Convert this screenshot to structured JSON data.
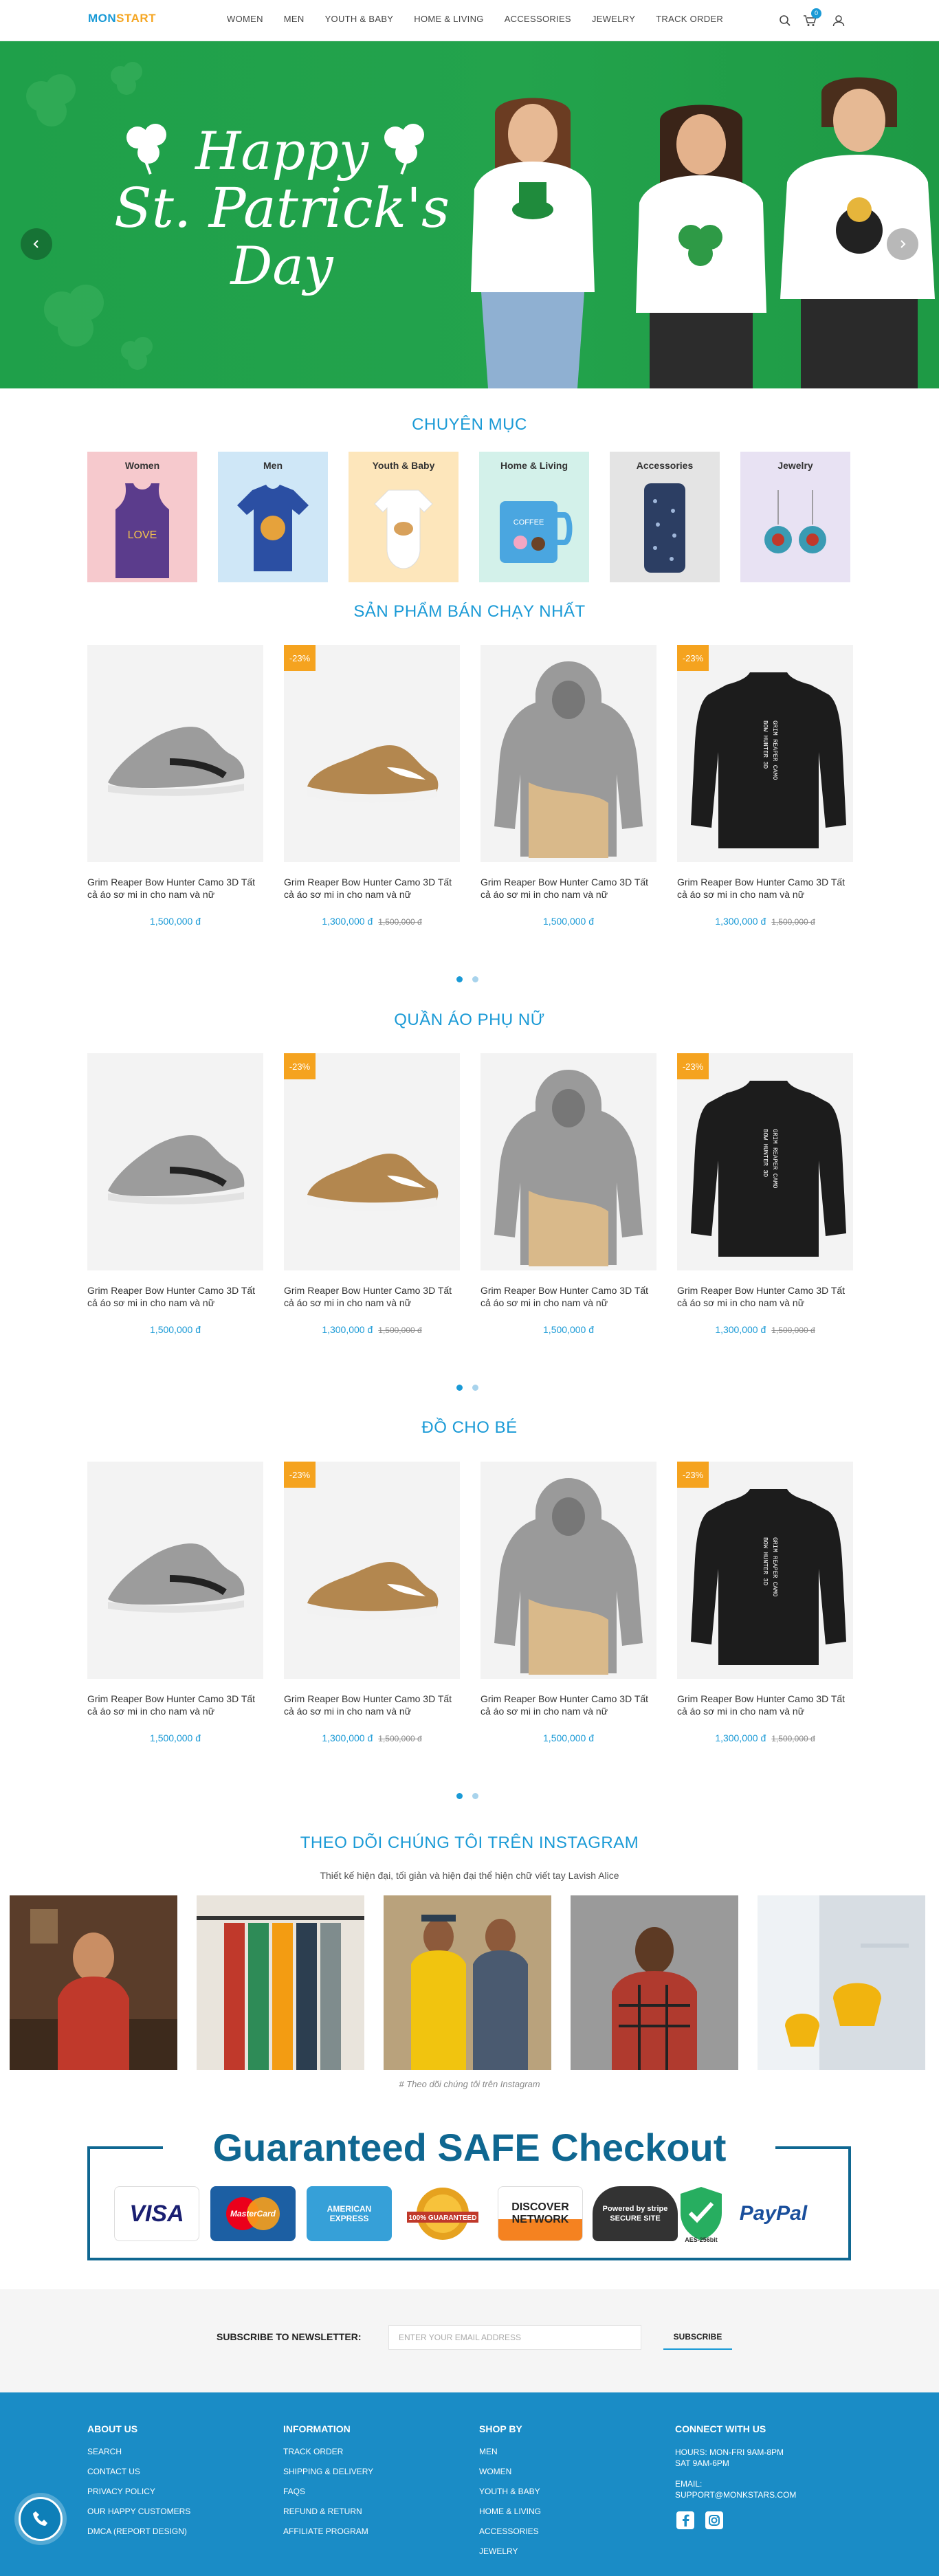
{
  "header": {
    "logo_part1": "MON",
    "logo_part2": "START",
    "nav": [
      "WOMEN",
      "MEN",
      "YOUTH & BABY",
      "HOME & LIVING",
      "ACCESSORIES",
      "JEWELRY",
      "TRACK ORDER"
    ],
    "cart_count": "0"
  },
  "hero": {
    "line1": "Happy",
    "line2": "St. Patrick's",
    "line3": "Day"
  },
  "categories": {
    "title": "CHUYÊN MỤC",
    "items": [
      {
        "label": "Women",
        "bg": "#f6c9cd"
      },
      {
        "label": "Men",
        "bg": "#cfe7f7"
      },
      {
        "label": "Youth & Baby",
        "bg": "#fde6bb"
      },
      {
        "label": "Home & Living",
        "bg": "#d3f1ea"
      },
      {
        "label": "Accessories",
        "bg": "#e4e4e4"
      },
      {
        "label": "Jewelry",
        "bg": "#e8e2f3"
      }
    ]
  },
  "sections": [
    {
      "title": "SẢN PHẨM BÁN CHẠY NHẤT",
      "products": [
        {
          "name": "Grim Reaper Bow Hunter Camo 3D Tất cả áo sơ mi in cho nam và nữ",
          "price": "1,500,000 đ",
          "old_price": "",
          "badge": ""
        },
        {
          "name": "Grim Reaper Bow Hunter Camo 3D Tất cả áo sơ mi in cho nam và nữ",
          "price": "1,300,000 đ",
          "old_price": "1,500,000 đ",
          "badge": "-23%"
        },
        {
          "name": "Grim Reaper Bow Hunter Camo 3D Tất cả áo sơ mi in cho nam và nữ",
          "price": "1,500,000 đ",
          "old_price": "",
          "badge": ""
        },
        {
          "name": "Grim Reaper Bow Hunter Camo 3D Tất cả áo sơ mi in cho nam và nữ",
          "price": "1,300,000 đ",
          "old_price": "1,500,000 đ",
          "badge": "-23%"
        }
      ]
    },
    {
      "title": "QUẦN ÁO PHỤ NỮ",
      "products": [
        {
          "name": "Grim Reaper Bow Hunter Camo 3D Tất cả áo sơ mi in cho nam và nữ",
          "price": "1,500,000 đ",
          "old_price": "",
          "badge": ""
        },
        {
          "name": "Grim Reaper Bow Hunter Camo 3D Tất cả áo sơ mi in cho nam và nữ",
          "price": "1,300,000 đ",
          "old_price": "1,500,000 đ",
          "badge": "-23%"
        },
        {
          "name": "Grim Reaper Bow Hunter Camo 3D Tất cả áo sơ mi in cho nam và nữ",
          "price": "1,500,000 đ",
          "old_price": "",
          "badge": ""
        },
        {
          "name": "Grim Reaper Bow Hunter Camo 3D Tất cả áo sơ mi in cho nam và nữ",
          "price": "1,300,000 đ",
          "old_price": "1,500,000 đ",
          "badge": "-23%"
        }
      ]
    },
    {
      "title": "ĐỒ CHO BÉ",
      "products": [
        {
          "name": "Grim Reaper Bow Hunter Camo 3D Tất cả áo sơ mi in cho nam và nữ",
          "price": "1,500,000 đ",
          "old_price": "",
          "badge": ""
        },
        {
          "name": "Grim Reaper Bow Hunter Camo 3D Tất cả áo sơ mi in cho nam và nữ",
          "price": "1,300,000 đ",
          "old_price": "1,500,000 đ",
          "badge": "-23%"
        },
        {
          "name": "Grim Reaper Bow Hunter Camo 3D Tất cả áo sơ mi in cho nam và nữ",
          "price": "1,500,000 đ",
          "old_price": "",
          "badge": ""
        },
        {
          "name": "Grim Reaper Bow Hunter Camo 3D Tất cả áo sơ mi in cho nam và nữ",
          "price": "1,300,000 đ",
          "old_price": "1,500,000 đ",
          "badge": "-23%"
        }
      ]
    }
  ],
  "instagram": {
    "title": "THEO DÕI CHÚNG TÔI TRÊN INSTAGRAM",
    "subtitle": "Thiết kế hiện đại, tối giản và hiện đại thể hiện chữ viết tay Lavish Alice",
    "caption": "# Theo dõi chúng tôi trên Instagram"
  },
  "safe_checkout": {
    "title": "Guaranteed SAFE Checkout",
    "logos": [
      {
        "label": "VISA"
      },
      {
        "label": "MasterCard"
      },
      {
        "label": "AMERICAN EXPRESS"
      },
      {
        "label": "100% GUARANTEED"
      },
      {
        "label": "DISCOVER NETWORK"
      },
      {
        "label": "Powered by stripe SECURE SITE"
      },
      {
        "label": "AES-256bit"
      },
      {
        "label": "PayPal"
      }
    ]
  },
  "newsletter": {
    "label": "SUBSCRIBE TO NEWSLETTER:",
    "placeholder": "ENTER YOUR EMAIL ADDRESS",
    "button": "SUBSCRIBE"
  },
  "footer": {
    "about": {
      "title": "ABOUT US",
      "links": [
        "SEARCH",
        "CONTACT US",
        "PRIVACY POLICY",
        "OUR HAPPY CUSTOMERS",
        "DMCA (REPORT DESIGN)"
      ]
    },
    "information": {
      "title": "INFORMATION",
      "links": [
        "TRACK ORDER",
        "SHIPPING & DELIVERY",
        "FAQS",
        "REFUND & RETURN",
        "AFFILIATE PROGRAM"
      ]
    },
    "shop_by": {
      "title": "SHOP BY",
      "links": [
        "MEN",
        "WOMEN",
        "YOUTH & BABY",
        "HOME & LIVING",
        "ACCESSORIES",
        "JEWELRY"
      ]
    },
    "connect": {
      "title": "CONNECT WITH US",
      "hours1": "HOURS: MON-FRI 9AM-8PM",
      "hours2": "SAT 9AM-6PM",
      "email_label": "EMAIL:",
      "email": "SUPPORT@MONKSTARS.COM"
    }
  }
}
